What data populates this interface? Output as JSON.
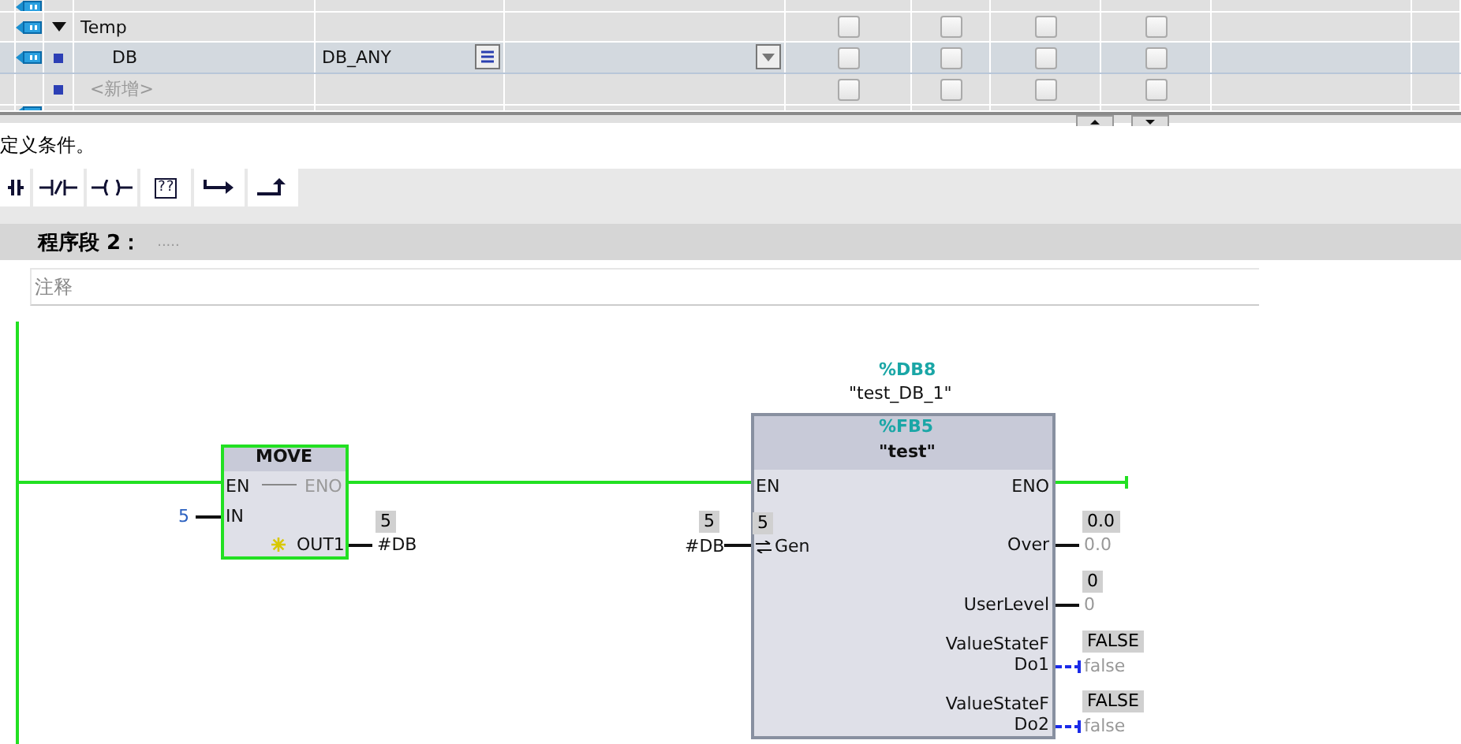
{
  "interface_table": {
    "rows": [
      {
        "kind": "partial"
      },
      {
        "kind": "section",
        "name": "Temp",
        "expanded": true,
        "checks": [
          false,
          false,
          false,
          false
        ]
      },
      {
        "kind": "variable",
        "name": "DB",
        "data_type": "DB_ANY",
        "selected": true,
        "checks": [
          false,
          false,
          false,
          false
        ]
      },
      {
        "kind": "add",
        "name": "<新增>",
        "selected": false,
        "checks": [
          false,
          false,
          false,
          false
        ]
      },
      {
        "kind": "partial"
      }
    ]
  },
  "hint_text": "定义条件。",
  "toolbar": [
    {
      "kind": "contact"
    },
    {
      "kind": "nc-contact"
    },
    {
      "kind": "coil"
    },
    {
      "kind": "box",
      "text": "??"
    },
    {
      "kind": "branch-open"
    },
    {
      "kind": "branch-close"
    }
  ],
  "network": {
    "title": "程序段 2：",
    "title_placeholder": ".....",
    "comment_placeholder": "注释"
  },
  "diagram": {
    "energized": true,
    "move": {
      "title": "MOVE",
      "en": "EN",
      "eno": "ENO",
      "eno_active": false,
      "in": "IN",
      "in_value": "5",
      "out": "OUT1",
      "out_monitor": "5",
      "out_operand": "#DB"
    },
    "fb": {
      "instance_address": "%DB8",
      "instance_name": "\"test_DB_1\"",
      "address": "%FB5",
      "name": "\"test\"",
      "en": "EN",
      "eno": "ENO",
      "input": {
        "name": "Gen",
        "inner_value": "5",
        "monitor": "5",
        "operand": "#DB"
      },
      "outputs": [
        {
          "name": "Over",
          "monitor": "0.0",
          "value": "0.0",
          "kind": "solid"
        },
        {
          "name": "UserLevel",
          "monitor": "0",
          "value": "0",
          "kind": "solid"
        },
        {
          "name": "ValueStateF\nDo1",
          "monitor": "FALSE",
          "value": "false",
          "kind": "bool"
        },
        {
          "name": "ValueStateF\nDo2",
          "monitor": "FALSE",
          "value": "false",
          "kind": "bool"
        }
      ]
    }
  }
}
